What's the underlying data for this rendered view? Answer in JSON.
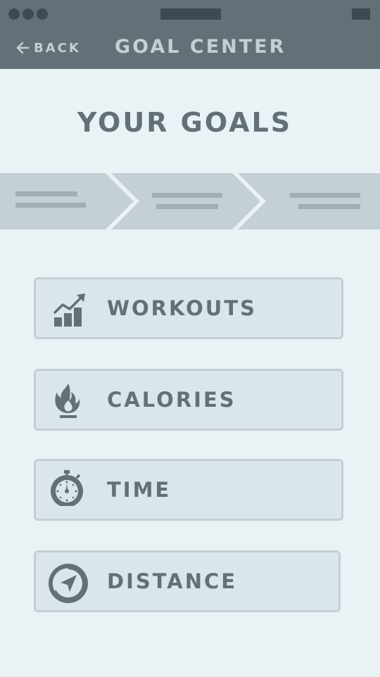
{
  "header": {
    "back_label": "BACK",
    "title": "GOAL CENTER"
  },
  "page_title": "YOUR GOALS",
  "goals": [
    {
      "label": "WORKOUTS",
      "icon": "bar-chart-trend-icon"
    },
    {
      "label": "CALORIES",
      "icon": "flame-icon"
    },
    {
      "label": "TIME",
      "icon": "stopwatch-icon"
    },
    {
      "label": "DISTANCE",
      "icon": "compass-icon"
    }
  ],
  "colors": {
    "background": "#e9f3f6",
    "header": "#637077",
    "header_text": "#c4d0d5",
    "status_bar": "#3d4a51",
    "stepper": "#c4d0d5",
    "stepper_lines": "#637077",
    "button_fill": "#dbe6ec",
    "button_border": "#c3cfd4",
    "text_dark": "#637077"
  }
}
